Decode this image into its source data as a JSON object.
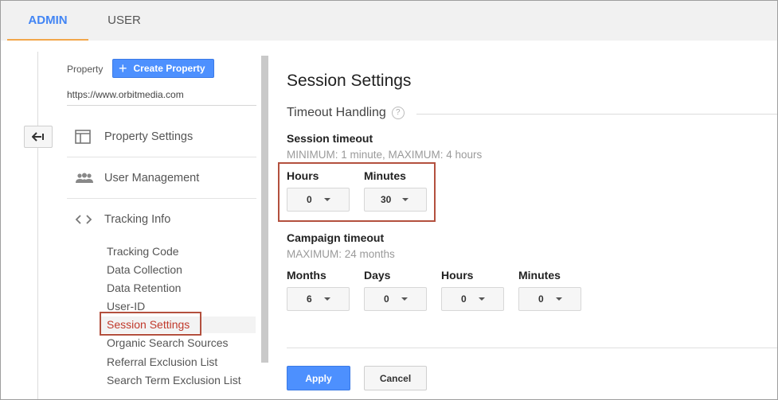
{
  "tabs": {
    "admin": "ADMIN",
    "user": "USER"
  },
  "sidebar": {
    "property_label": "Property",
    "create_button": "Create Property",
    "url": "https://www.orbitmedia.com",
    "items": [
      {
        "label": "Property Settings",
        "icon": "property-settings-icon"
      },
      {
        "label": "User Management",
        "icon": "people-icon"
      },
      {
        "label": "Tracking Info",
        "icon": "code-brackets-icon"
      }
    ],
    "subitems": [
      "Tracking Code",
      "Data Collection",
      "Data Retention",
      "User-ID",
      "Session Settings",
      "Organic Search Sources",
      "Referral Exclusion List",
      "Search Term Exclusion List"
    ],
    "active_subitem": "Session Settings"
  },
  "main": {
    "title": "Session Settings",
    "section": "Timeout Handling",
    "help_glyph": "?",
    "session_timeout": {
      "label": "Session timeout",
      "hint": "MINIMUM: 1 minute, MAXIMUM: 4 hours",
      "hours_label": "Hours",
      "hours_value": "0",
      "minutes_label": "Minutes",
      "minutes_value": "30"
    },
    "campaign_timeout": {
      "label": "Campaign timeout",
      "hint": "MAXIMUM: 24 months",
      "months_label": "Months",
      "months_value": "6",
      "days_label": "Days",
      "days_value": "0",
      "hours_label": "Hours",
      "hours_value": "0",
      "minutes_label": "Minutes",
      "minutes_value": "0"
    },
    "apply": "Apply",
    "cancel": "Cancel"
  },
  "colors": {
    "accent": "#4285f4",
    "button_blue": "#4d90fe",
    "highlight": "#b3503e",
    "tab_underline": "#f2a74b"
  }
}
